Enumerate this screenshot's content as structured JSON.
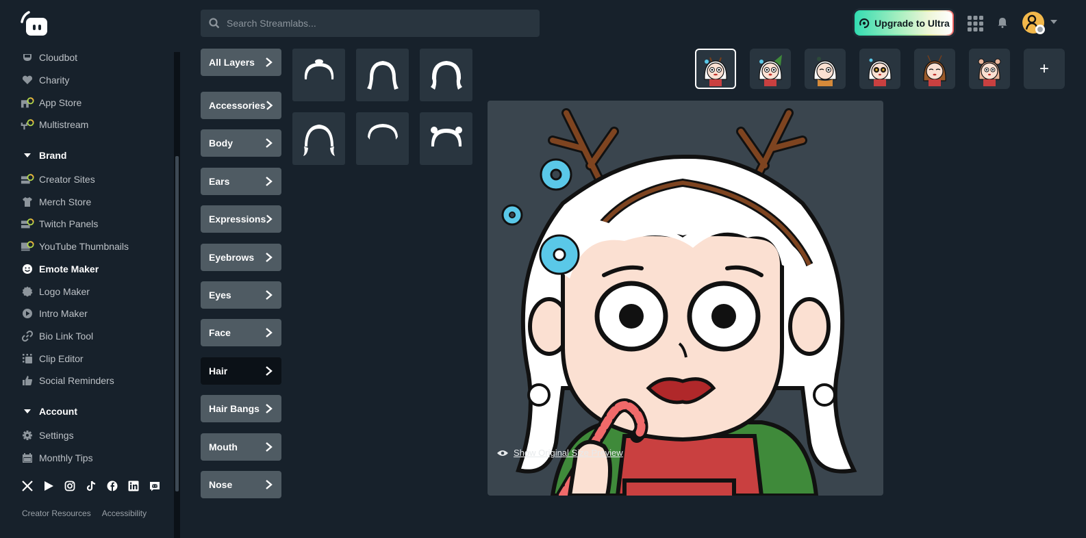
{
  "sidebar": {
    "items_top": [
      {
        "label": "Cloudbot",
        "icon": "cloudbot-icon"
      },
      {
        "label": "Charity",
        "icon": "heart-icon"
      },
      {
        "label": "App Store",
        "icon": "app-store-icon"
      },
      {
        "label": "Multistream",
        "icon": "multistream-icon"
      }
    ],
    "brand_section": "Brand",
    "brand_items": [
      {
        "label": "Creator Sites",
        "icon": "creator-sites-icon"
      },
      {
        "label": "Merch Store",
        "icon": "shirt-icon"
      },
      {
        "label": "Twitch Panels",
        "icon": "twitch-panels-icon"
      },
      {
        "label": "YouTube Thumbnails",
        "icon": "youtube-thumbnails-icon"
      },
      {
        "label": "Emote Maker",
        "icon": "smiley-icon",
        "active": true
      },
      {
        "label": "Logo Maker",
        "icon": "badge-icon"
      },
      {
        "label": "Intro Maker",
        "icon": "play-circle-icon"
      },
      {
        "label": "Bio Link Tool",
        "icon": "link-icon"
      },
      {
        "label": "Clip Editor",
        "icon": "clip-icon"
      },
      {
        "label": "Social Reminders",
        "icon": "thumbs-up-icon"
      }
    ],
    "account_section": "Account",
    "account_items": [
      {
        "label": "Settings",
        "icon": "gear-icon"
      },
      {
        "label": "Monthly Tips",
        "icon": "calendar-icon"
      }
    ],
    "socials": [
      "x-icon",
      "youtube-icon",
      "instagram-icon",
      "tiktok-icon",
      "facebook-icon",
      "linkedin-icon",
      "discord-icon"
    ],
    "footer": {
      "creator_resources": "Creator Resources",
      "accessibility": "Accessibility"
    }
  },
  "header": {
    "search_placeholder": "Search Streamlabs...",
    "upgrade_label": "Upgrade to Ultra"
  },
  "categories": [
    {
      "label": "All Layers"
    },
    {
      "label": "Accessories"
    },
    {
      "label": "Body"
    },
    {
      "label": "Ears"
    },
    {
      "label": "Expressions"
    },
    {
      "label": "Eyebrows"
    },
    {
      "label": "Eyes"
    },
    {
      "label": "Face"
    },
    {
      "label": "Hair",
      "active": true
    },
    {
      "label": "Hair Bangs"
    },
    {
      "label": "Mouth"
    },
    {
      "label": "Nose"
    }
  ],
  "hair_items": [
    "hair-bun",
    "hair-long",
    "hair-wavy",
    "hair-braids",
    "hair-short",
    "hair-buns"
  ],
  "emotes": [
    {
      "name": "reindeer-candycane",
      "hair": "#ffffff",
      "selected": true
    },
    {
      "name": "elf-hat",
      "hair": "#ffffff"
    },
    {
      "name": "wink-mistletoe",
      "hair": "#ffffff"
    },
    {
      "name": "starry-eyes",
      "hair": "#ffffff"
    },
    {
      "name": "antenna-brown",
      "hair": "#9a5a2a"
    },
    {
      "name": "bear-ears",
      "hair": "#e9b49a"
    }
  ],
  "add_emote": "+",
  "preview": {
    "link_label": "Show Original Size Preview"
  },
  "colors": {
    "background": "#17212b",
    "panel": "#29353f",
    "category": "#4f5b63",
    "category_active": "#0b1117",
    "canvas": "#3a454e"
  }
}
